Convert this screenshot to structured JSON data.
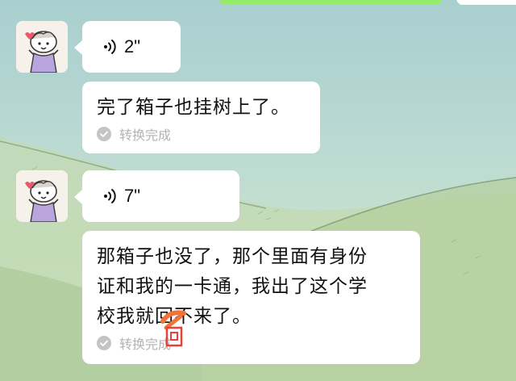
{
  "icons": {
    "voice": "voice-wave-icon",
    "check": "check-circle-icon",
    "avatar": "cartoon-avatar"
  },
  "colors": {
    "bubble": "#ffffff",
    "sent_bubble": "#95ec69",
    "muted_text": "#b3b3b3"
  },
  "messages": [
    {
      "type": "voice",
      "duration": "2\""
    },
    {
      "type": "transcript",
      "text": "完了箱子也挂树上了。",
      "status": "转换完成"
    },
    {
      "type": "voice",
      "duration": "7\""
    },
    {
      "type": "transcript",
      "lines": [
        "那箱子也没了，那个里面有身份",
        "证和我的一卡通，我出了这个学",
        "校我就回不来了。"
      ],
      "status": "转换完成"
    }
  ]
}
